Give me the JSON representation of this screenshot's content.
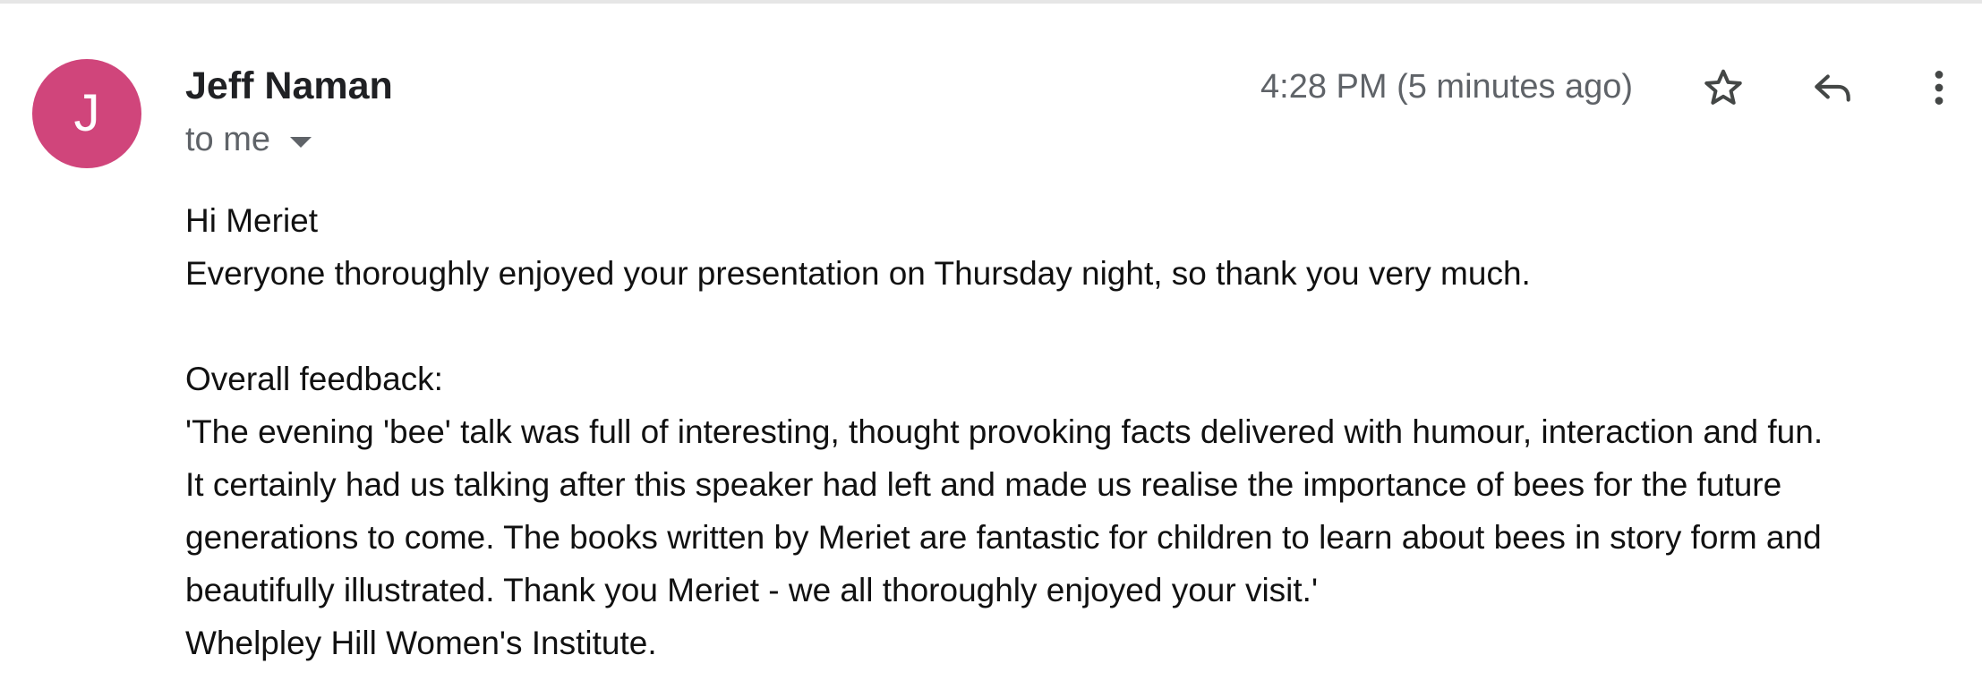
{
  "message": {
    "sender": {
      "initial": "J",
      "name": "Jeff Naman",
      "avatar_color": "#d0457b"
    },
    "recipient_label": "to me",
    "timestamp": "4:28 PM (5 minutes ago)",
    "actions": {
      "star_icon": "star-icon",
      "reply_icon": "reply-icon",
      "more_icon": "more-vert-icon"
    },
    "body": {
      "greeting": "Hi Meriet",
      "intro": "Everyone thoroughly enjoyed your presentation on Thursday night, so thank you very much.",
      "feedback_heading": "Overall feedback:",
      "quote_lines": [
        "'The evening 'bee' talk was full of interesting, thought provoking facts delivered  with humour, interaction and fun.",
        "It certainly had us talking after this speaker had left and made us realise the importance of bees for the future",
        "generations to come. The books written by Meriet are fantastic for children to learn about bees in story form and",
        "beautifully illustrated. Thank you Meriet - we all thoroughly enjoyed your visit.'"
      ],
      "signature": "Whelpley Hill Women's Institute."
    }
  }
}
